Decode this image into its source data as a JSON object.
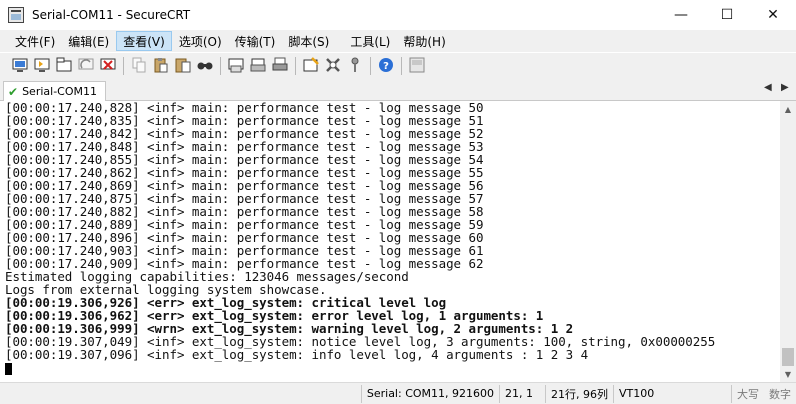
{
  "window": {
    "title": "Serial-COM11 - SecureCRT",
    "controls": {
      "minimize": "—",
      "maximize": "☐",
      "close": "✕"
    }
  },
  "menubar": {
    "items": [
      {
        "label": "文件(F)"
      },
      {
        "label": "编辑(E)"
      },
      {
        "label": "查看(V)",
        "active": true
      },
      {
        "label": "选项(O)"
      },
      {
        "label": "传输(T)"
      },
      {
        "label": "脚本(S)"
      },
      {
        "label": "工具(L)"
      },
      {
        "label": "帮助(H)"
      }
    ]
  },
  "toolbar": {
    "icons": [
      "connect-icon",
      "quick-connect-icon",
      "connect-tab-icon",
      "reconnect-icon",
      "disconnect-icon",
      "copy-icon",
      "paste-icon",
      "copy-paste-icon",
      "find-icon",
      "print-screen-icon",
      "print-selection-icon",
      "print-icon",
      "session-options-icon",
      "global-options-icon",
      "keymap-icon",
      "help-icon",
      "sftp-icon"
    ]
  },
  "tabbar": {
    "tab_label": "Serial-COM11",
    "nav_left": "◀",
    "nav_right": "▶"
  },
  "terminal": {
    "lines": [
      {
        "text": "[00:00:17.240,828] <inf> main: performance test - log message 50",
        "bold": false
      },
      {
        "text": "[00:00:17.240,835] <inf> main: performance test - log message 51",
        "bold": false
      },
      {
        "text": "[00:00:17.240,842] <inf> main: performance test - log message 52",
        "bold": false
      },
      {
        "text": "[00:00:17.240,848] <inf> main: performance test - log message 53",
        "bold": false
      },
      {
        "text": "[00:00:17.240,855] <inf> main: performance test - log message 54",
        "bold": false
      },
      {
        "text": "[00:00:17.240,862] <inf> main: performance test - log message 55",
        "bold": false
      },
      {
        "text": "[00:00:17.240,869] <inf> main: performance test - log message 56",
        "bold": false
      },
      {
        "text": "[00:00:17.240,875] <inf> main: performance test - log message 57",
        "bold": false
      },
      {
        "text": "[00:00:17.240,882] <inf> main: performance test - log message 58",
        "bold": false
      },
      {
        "text": "[00:00:17.240,889] <inf> main: performance test - log message 59",
        "bold": false
      },
      {
        "text": "[00:00:17.240,896] <inf> main: performance test - log message 60",
        "bold": false
      },
      {
        "text": "[00:00:17.240,903] <inf> main: performance test - log message 61",
        "bold": false
      },
      {
        "text": "[00:00:17.240,909] <inf> main: performance test - log message 62",
        "bold": false
      },
      {
        "text": "Estimated logging capabilities: 123046 messages/second",
        "bold": false
      },
      {
        "text": "Logs from external logging system showcase.",
        "bold": false
      },
      {
        "text": "[00:00:19.306,926] <err> ext_log_system: critical level log",
        "bold": true
      },
      {
        "text": "[00:00:19.306,962] <err> ext_log_system: error level log, 1 arguments: 1",
        "bold": true
      },
      {
        "text": "[00:00:19.306,999] <wrn> ext_log_system: warning level log, 2 arguments: 1 2",
        "bold": true
      },
      {
        "text": "[00:00:19.307,049] <inf> ext_log_system: notice level log, 3 arguments: 100, string, 0x00000255",
        "bold": false
      },
      {
        "text": "[00:00:19.307,096] <inf> ext_log_system: info level log, 4 arguments : 1 2 3 4",
        "bold": false
      }
    ]
  },
  "statusbar": {
    "connection": "Serial: COM11, 921600",
    "position": "21,  1",
    "rows_cols": "21行, 96列",
    "terminal_type": "VT100",
    "caps": "大写",
    "num": "数字"
  }
}
